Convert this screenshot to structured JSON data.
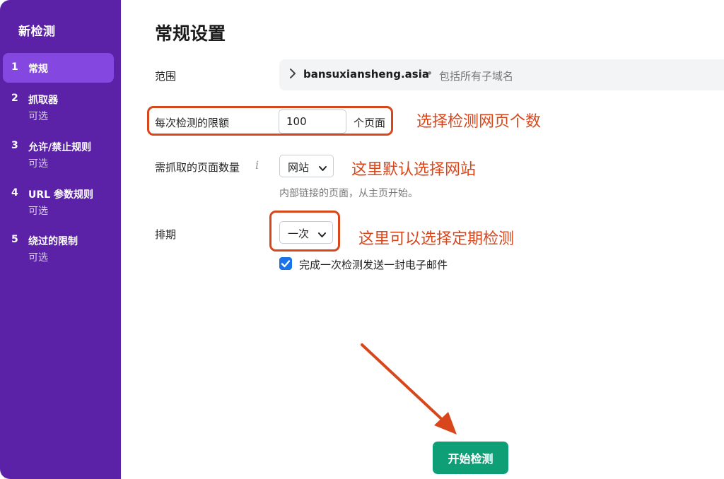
{
  "sidebar": {
    "title": "新检测",
    "steps": [
      {
        "num": "1",
        "label": "常规",
        "sub": ""
      },
      {
        "num": "2",
        "label": "抓取器",
        "sub": "可选"
      },
      {
        "num": "3",
        "label": "允许/禁止规则",
        "sub": "可选"
      },
      {
        "num": "4",
        "label": "URL 参数规则",
        "sub": "可选"
      },
      {
        "num": "5",
        "label": "绕过的限制",
        "sub": "可选"
      }
    ]
  },
  "main": {
    "title": "常规设置",
    "scope": {
      "label": "范围",
      "domain": "bansuxiansheng.asia",
      "separator": "•",
      "note": "包括所有子域名"
    },
    "limit": {
      "label": "每次检测的限额",
      "value": "100",
      "unit": "个页面"
    },
    "pages_to_crawl": {
      "label": "需抓取的页面数量",
      "info": "i",
      "selected": "网站",
      "hint": "内部链接的页面，从主页开始。"
    },
    "schedule": {
      "label": "排期",
      "selected": "一次",
      "email_checkbox_label": "完成一次检测发送一封电子邮件",
      "email_checked": true
    },
    "start_button": "开始检测"
  },
  "annotations": {
    "limit_note": "选择检测网页个数",
    "crawl_note": "这里默认选择网站",
    "schedule_note": "这里可以选择定期检测"
  },
  "colors": {
    "sidebar_bg": "#5b22a8",
    "sidebar_active": "#8447e0",
    "primary_button": "#0e9f76",
    "annotation": "#d8461b",
    "checkbox": "#1a73e8"
  }
}
